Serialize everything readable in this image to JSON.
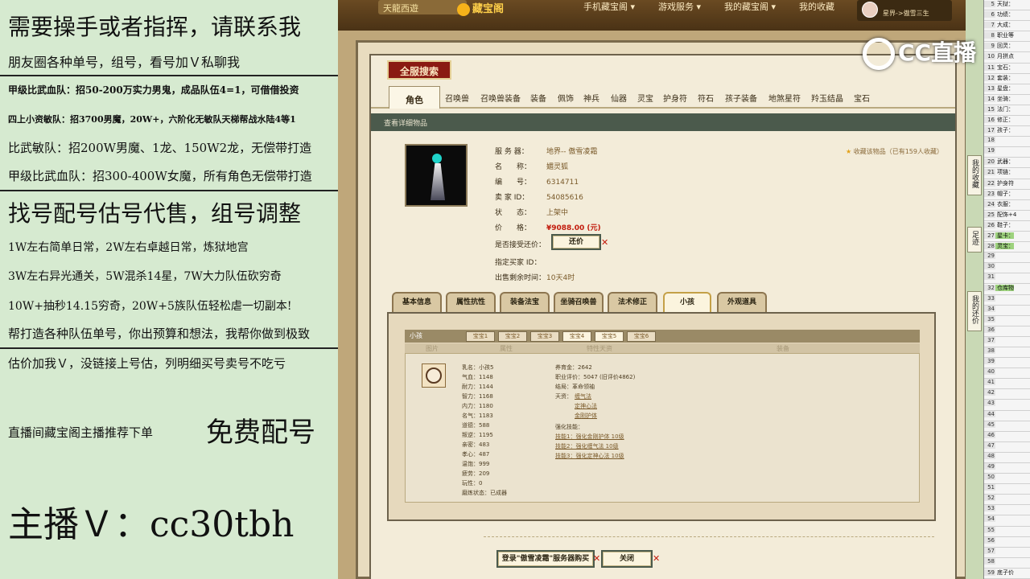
{
  "overlay": {
    "lines": [
      "需要操手或者指挥，请联系我",
      "朋友圈各种单号，组号，看号加Ｖ私聊我",
      "甲级比武血队：招50-200万实力男鬼，成品队伍4=1，可借借投资",
      "四上小资敏队：招3700男魔，20W+，六阶化无敏队天梯帮战水陆4等1",
      "比武敏队：招200W男魔、1龙、150W2龙，无偿带打造",
      "甲级比武血队：招300-400W女魔，所有角色无偿带打造",
      "找号配号估号代售，组号调整",
      "1W左右简单日常，2W左右卓越日常，炼狱地宫",
      "3W左右异光通关，5W混杀14星，7W大力队伍砍穷奇",
      "10W+抽秒14.15穷奇，20W+5族队伍轻松虐一切副本!",
      "帮打造各种队伍单号，你出预算和想法，我帮你做到极致",
      "估价加我Ｖ，没链接上号估，列明细买号卖号不吃亏",
      "直播间藏宝阁主播推荐下单",
      "免费配号",
      "主播Ｖ：cc30tbh"
    ]
  },
  "topbar": {
    "logo_text": "天龍西遊",
    "site_name": "藏宝阁",
    "nav": [
      "手机藏宝阁 ▾",
      "游戏服务 ▾",
      "我的藏宝阁 ▾",
      "我的收藏"
    ],
    "user_server": "星界->傲雪三生"
  },
  "search_title": "全服搜索",
  "category_tabs": [
    "角色",
    "召唤兽",
    "召唤兽装备",
    "装备",
    "佩饰",
    "神兵",
    "仙器",
    "灵宝",
    "护身符",
    "符石",
    "孩子装备",
    "地煞星符",
    "羚玉结晶",
    "宝石"
  ],
  "detail_bar": "查看详细物品",
  "item": {
    "server_label": "服 务 器：",
    "server_value": "地界-- 傲雪凌霜",
    "name_label": "名　　称：",
    "name_value": "媚灵狐",
    "id_label": "编　　号：",
    "id_value": "6314711",
    "seller_label": "卖 家 ID：",
    "seller_value": "54085616",
    "status_label": "状　　态：",
    "status_value": "上架中",
    "price_label": "价　　格：",
    "price_value": "¥9088.00 (元)",
    "bargain_label": "是否接受还价：",
    "buyer_label": "指定买家 ID：",
    "time_label": "出售剩余时间：",
    "time_value": "10天4时",
    "favorite": "收藏该物品（已有159人收藏）"
  },
  "buttons": {
    "bargain": "还价",
    "login_buy": "登录\"傲雪凌霜\"服务器购买",
    "close": "关闭"
  },
  "sub_tabs": [
    "基本信息",
    "属性抗性",
    "装备法宝",
    "坐骑召唤兽",
    "法术修正",
    "小孩",
    "外观道具"
  ],
  "child_panel": {
    "header": "小孩",
    "gem_tabs": [
      "宝宝1",
      "宝宝2",
      "宝宝3",
      "宝宝4",
      "宝宝5",
      "宝宝6"
    ],
    "col_headers": [
      "图片",
      "属性",
      "特性天资",
      "装备"
    ],
    "stats_left": [
      "乳名：小孩5",
      "气血：1148",
      "耐力：1144",
      "智力：1168",
      "内力：1180",
      "名气：1183",
      "道德：588",
      "叛逆：1195",
      "亲密：483",
      "孝心：487",
      "温饱：999",
      "疲劳：209",
      "玩性：0",
      "磨炼状态：已成器"
    ],
    "stats_right": [
      "养育金：2642",
      "职业评价：5047 (旧评价4862)",
      "结局：革命领袖",
      "天资："
    ],
    "talents": [
      "缠气法",
      "定神心法",
      "金刚护体"
    ],
    "skills_label": "强化技能：",
    "skills": [
      "技能1：强化金刚护体 10级",
      "技能2：强化缠气法 10级",
      "技能3：强化定神心法 10级"
    ]
  },
  "right_tabs": [
    "我的收藏",
    "足迹",
    "我的还价"
  ],
  "watermark": "CC直播",
  "sheet": {
    "rows": [
      [
        "5",
        "天狱："
      ],
      [
        "6",
        "功绩："
      ],
      [
        "7",
        "大成："
      ],
      [
        "8",
        "职业等"
      ],
      [
        "9",
        "回灵："
      ],
      [
        "10",
        "月拼点"
      ],
      [
        "11",
        "宝石："
      ],
      [
        "12",
        "套装："
      ],
      [
        "13",
        "星盘："
      ],
      [
        "14",
        "坐骑："
      ],
      [
        "15",
        "法门："
      ],
      [
        "16",
        "修正："
      ],
      [
        "17",
        "孩子："
      ],
      [
        "18",
        ""
      ],
      [
        "19",
        ""
      ],
      [
        "20",
        "武器："
      ],
      [
        "21",
        "项链："
      ],
      [
        "22",
        "护身符"
      ],
      [
        "23",
        "帽子："
      ],
      [
        "24",
        "衣服："
      ],
      [
        "25",
        "配饰+4"
      ],
      [
        "26",
        "鞋子："
      ],
      [
        "27",
        "星卡："
      ],
      [
        "28",
        "灵宝："
      ],
      [
        "29",
        ""
      ],
      [
        "30",
        ""
      ],
      [
        "31",
        ""
      ],
      [
        "32",
        "仓库物"
      ],
      [
        "33",
        ""
      ],
      [
        "34",
        ""
      ],
      [
        "35",
        ""
      ],
      [
        "36",
        ""
      ],
      [
        "37",
        ""
      ],
      [
        "38",
        ""
      ],
      [
        "39",
        ""
      ],
      [
        "40",
        ""
      ],
      [
        "41",
        ""
      ],
      [
        "42",
        ""
      ],
      [
        "43",
        ""
      ],
      [
        "44",
        ""
      ],
      [
        "45",
        ""
      ],
      [
        "46",
        ""
      ],
      [
        "47",
        ""
      ],
      [
        "48",
        ""
      ],
      [
        "49",
        ""
      ],
      [
        "50",
        ""
      ],
      [
        "51",
        ""
      ],
      [
        "52",
        ""
      ],
      [
        "53",
        ""
      ],
      [
        "54",
        ""
      ],
      [
        "55",
        ""
      ],
      [
        "56",
        ""
      ],
      [
        "57",
        ""
      ],
      [
        "58",
        ""
      ],
      [
        "59",
        "底子价"
      ]
    ],
    "highlight_rows": [
      27,
      28,
      32
    ]
  }
}
